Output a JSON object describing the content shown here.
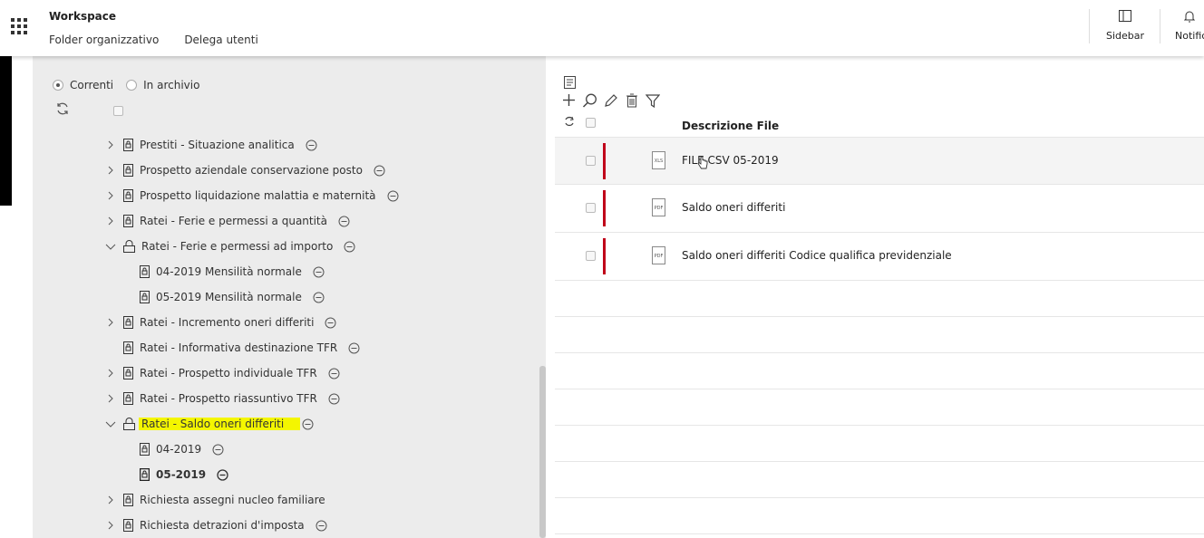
{
  "header": {
    "title": "Workspace",
    "nav": [
      "Folder organizzativo",
      "Delega utenti"
    ],
    "sidebar_label": "Sidebar",
    "notifications_label": "Notifiche"
  },
  "filters": {
    "current_label": "Correnti",
    "archive_label": "In archivio",
    "selected": "Correnti"
  },
  "tree": [
    {
      "label": "Prestiti - Situazione analitica",
      "expandable": true
    },
    {
      "label": "Prospetto aziendale conservazione posto",
      "expandable": true
    },
    {
      "label": "Prospetto liquidazione malattia e maternità",
      "expandable": true
    },
    {
      "label": "Ratei - Ferie e permessi a quantità",
      "expandable": true
    },
    {
      "label": "Ratei - Ferie e permessi ad importo",
      "expanded": true
    },
    {
      "label": "04-2019 Mensilità normale",
      "child": true
    },
    {
      "label": "05-2019 Mensilità normale",
      "child": true
    },
    {
      "label": "Ratei - Incremento oneri differiti",
      "expandable": true
    },
    {
      "label": "Ratei - Informativa destinazione TFR"
    },
    {
      "label": "Ratei - Prospetto individuale TFR",
      "expandable": true
    },
    {
      "label": "Ratei - Prospetto riassuntivo TFR",
      "expandable": true
    },
    {
      "label": "Ratei - Saldo oneri differiti",
      "expanded": true,
      "highlighted": true
    },
    {
      "label": "04-2019",
      "child": true
    },
    {
      "label": "05-2019",
      "child": true,
      "selected": true
    },
    {
      "label": "Richiesta assegni nucleo familiare",
      "expandable": true,
      "no_gear": true
    },
    {
      "label": "Richiesta detrazioni d'imposta",
      "expandable": true
    }
  ],
  "files": {
    "column_title": "Descrizione File",
    "rows": [
      {
        "type": "XLS",
        "name": "FILE CSV 05-2019"
      },
      {
        "type": "PDF",
        "name": "Saldo oneri differiti"
      },
      {
        "type": "PDF",
        "name": "Saldo oneri differiti Codice qualifica previdenziale"
      }
    ]
  },
  "colors": {
    "highlight": "#f4f600",
    "status_bar": "#c0001a",
    "panel_bg": "#ececec"
  }
}
